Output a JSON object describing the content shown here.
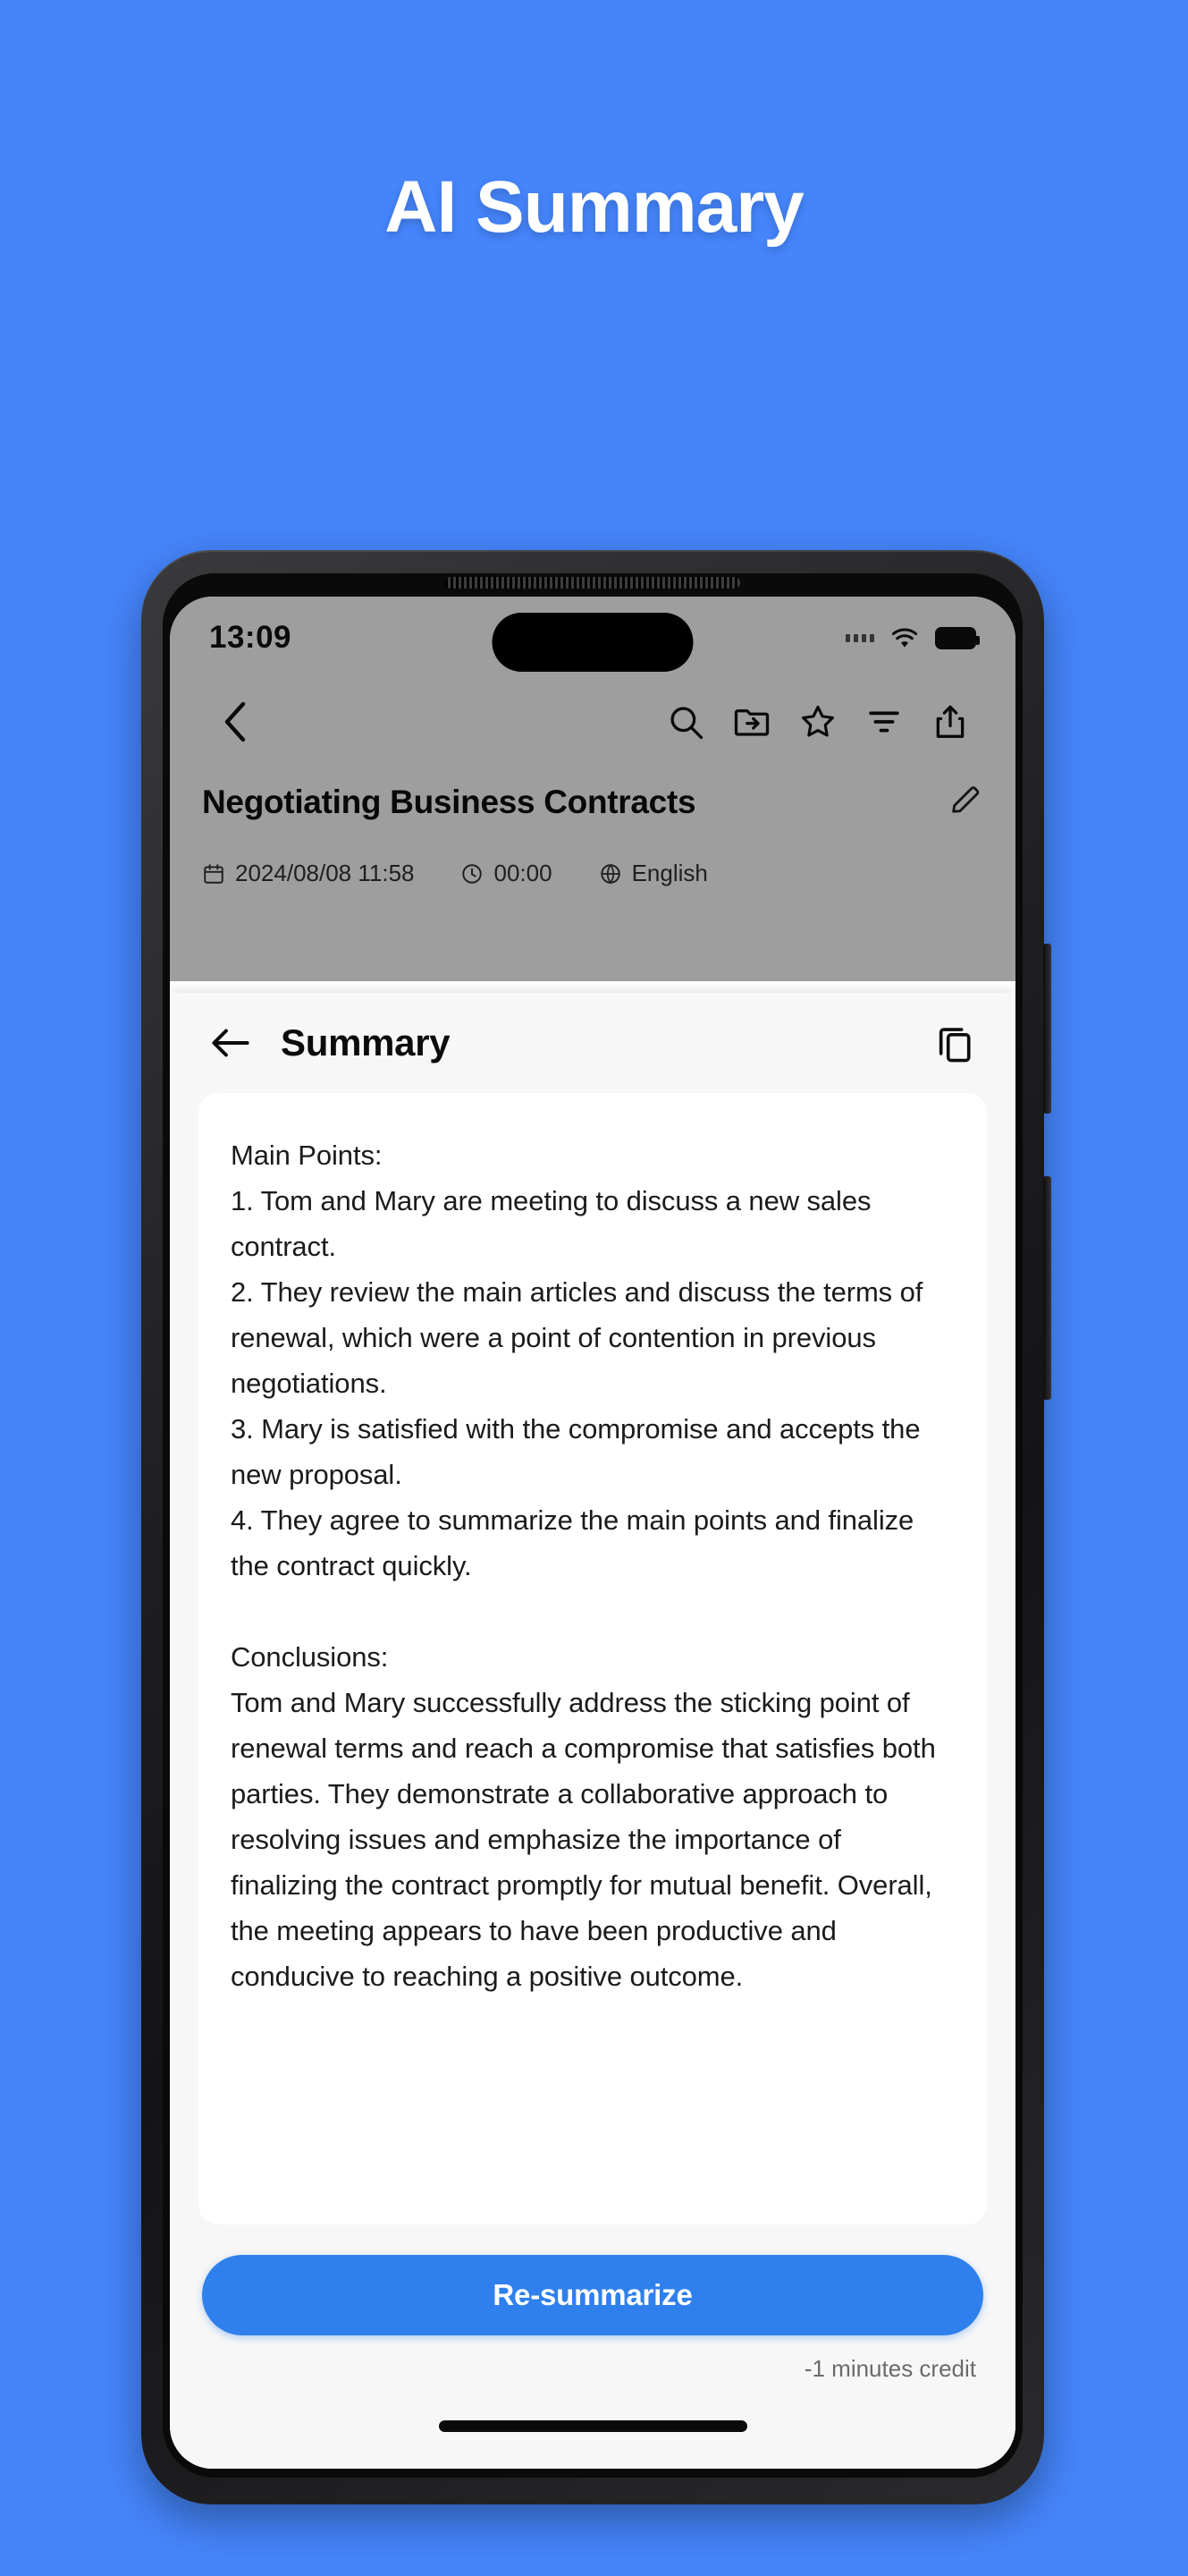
{
  "promo": {
    "title": "AI Summary",
    "background_color": "#4585fb",
    "title_color": "#ffffff"
  },
  "status_bar": {
    "time": "13:09",
    "icons": [
      "signal-dots-icon",
      "wifi-icon",
      "battery-icon"
    ]
  },
  "app": {
    "toolbar": {
      "back_icon": "back-chevron-icon",
      "actions": [
        "search-icon",
        "move-to-folder-icon",
        "star-icon",
        "filter-icon",
        "share-icon"
      ]
    },
    "title": "Negotiating Business Contracts",
    "edit_icon": "pencil-icon",
    "meta": {
      "date": "2024/08/08 11:58",
      "duration": "00:00",
      "language": "English"
    }
  },
  "sheet": {
    "back_icon": "arrow-left-icon",
    "title": "Summary",
    "copy_icon": "copy-icon",
    "summary_text": "Main Points:\n1. Tom and Mary are meeting to discuss a new sales contract.\n2. They review the main articles and discuss the terms of renewal, which were a point of contention in previous negotiations.\n3. Mary is satisfied with the compromise and accepts the new proposal.\n4. They agree to summarize the main points and finalize the contract quickly.\n\nConclusions:\nTom and Mary successfully address the sticking point of renewal terms and reach a compromise that satisfies both parties. They demonstrate a collaborative approach to resolving issues and emphasize the importance of finalizing the contract promptly for mutual benefit. Overall, the meeting appears to have been productive and conducive to reaching a positive outcome.",
    "primary_button": "Re-summarize",
    "credit_note": "-1 minutes credit",
    "accent_color": "#2f80ec"
  }
}
